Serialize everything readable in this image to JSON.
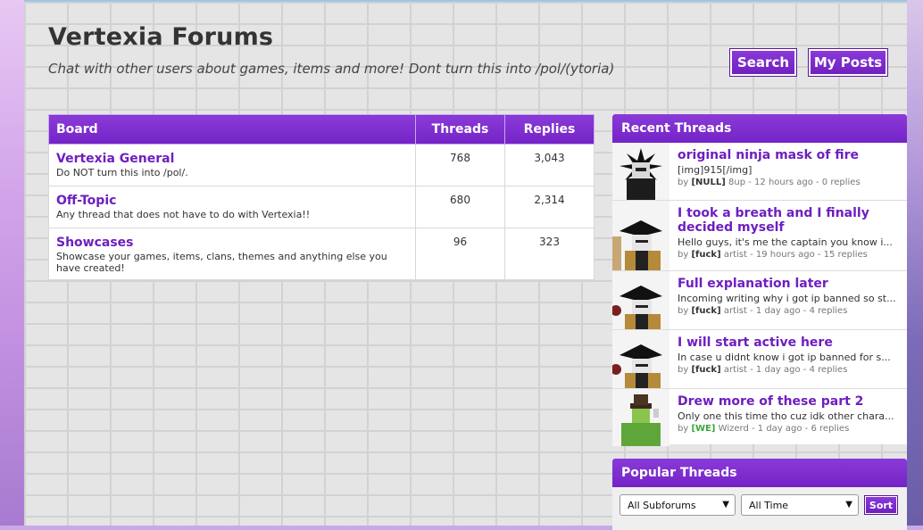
{
  "page": {
    "title": "Vertexia Forums",
    "subtitle": "Chat with other users about games, items and more! Dont turn this into /pol/(ytoria)",
    "search_label": "Search",
    "my_posts_label": "My Posts"
  },
  "board_table": {
    "headers": {
      "board": "Board",
      "threads": "Threads",
      "replies": "Replies"
    },
    "rows": [
      {
        "name": "Vertexia General",
        "desc": "Do NOT turn this into /pol/.",
        "threads": "768",
        "replies": "3,043"
      },
      {
        "name": "Off-Topic",
        "desc": "Any thread that does not have to do with Vertexia!!",
        "threads": "680",
        "replies": "2,314"
      },
      {
        "name": "Showcases",
        "desc": "Showcase your games, items, clans, themes and anything else you have created!",
        "threads": "96",
        "replies": "323"
      }
    ]
  },
  "recent": {
    "header": "Recent Threads",
    "threads": [
      {
        "title": "original ninja mask of fire",
        "snippet": "[img]915[/img]",
        "by": "by",
        "clan": "[NULL]",
        "user": "8up",
        "meta": "- 12 hours ago - 0 replies"
      },
      {
        "title": "I took a breath and I finally decided myself",
        "snippet": "Hello guys, it's me the captain you know i...",
        "by": "by",
        "clan": "[fuck]",
        "user": "artist",
        "meta": "- 19 hours ago - 15 replies"
      },
      {
        "title": "Full explanation later",
        "snippet": "Incoming writing why i got ip banned so st...",
        "by": "by",
        "clan": "[fuck]",
        "user": "artist",
        "meta": "- 1 day ago - 4 replies"
      },
      {
        "title": "I will start active here",
        "snippet": "In case u didnt know i got ip banned for s...",
        "by": "by",
        "clan": "[fuck]",
        "user": "artist",
        "meta": "- 1 day ago - 4 replies"
      },
      {
        "title": "Drew more of these part 2",
        "snippet": "Only one this time tho cuz idk other chara...",
        "by": "by",
        "clan": "[WE]",
        "user": "Wizerd",
        "meta": "- 1 day ago - 6 replies"
      }
    ]
  },
  "popular": {
    "header": "Popular Threads",
    "subforum_value": "All Subforums",
    "time_value": "All Time",
    "sort_label": "Sort"
  }
}
